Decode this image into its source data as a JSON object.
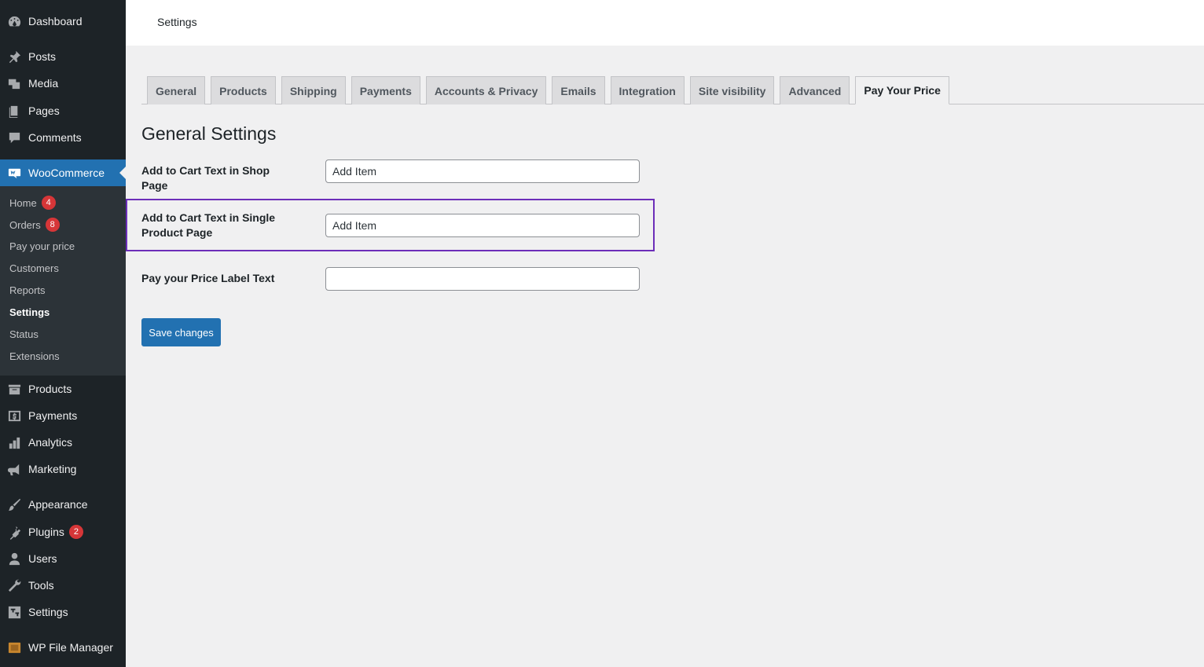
{
  "sidebar": {
    "menu": [
      {
        "label": "Dashboard",
        "icon": "dashboard-icon"
      },
      {
        "label": "Posts",
        "icon": "pin-icon"
      },
      {
        "label": "Media",
        "icon": "media-icon"
      },
      {
        "label": "Pages",
        "icon": "pages-icon"
      },
      {
        "label": "Comments",
        "icon": "comment-icon"
      },
      {
        "label": "WooCommerce",
        "icon": "woo-icon"
      },
      {
        "label": "Products",
        "icon": "archive-icon"
      },
      {
        "label": "Payments",
        "icon": "dollar-icon"
      },
      {
        "label": "Analytics",
        "icon": "bar-chart-icon"
      },
      {
        "label": "Marketing",
        "icon": "megaphone-icon"
      },
      {
        "label": "Appearance",
        "icon": "brush-icon"
      },
      {
        "label": "Plugins",
        "icon": "plug-icon",
        "badge": "2"
      },
      {
        "label": "Users",
        "icon": "user-icon"
      },
      {
        "label": "Tools",
        "icon": "wrench-icon"
      },
      {
        "label": "Settings",
        "icon": "settings-icon"
      },
      {
        "label": "WP File Manager",
        "icon": "file-manager-icon"
      }
    ],
    "submenu": [
      {
        "label": "Home",
        "badge": "4"
      },
      {
        "label": "Orders",
        "badge": "8"
      },
      {
        "label": "Pay your price"
      },
      {
        "label": "Customers"
      },
      {
        "label": "Reports"
      },
      {
        "label": "Settings"
      },
      {
        "label": "Status"
      },
      {
        "label": "Extensions"
      }
    ]
  },
  "header": {
    "title": "Settings"
  },
  "tabs": [
    {
      "label": "General"
    },
    {
      "label": "Products"
    },
    {
      "label": "Shipping"
    },
    {
      "label": "Payments"
    },
    {
      "label": "Accounts & Privacy"
    },
    {
      "label": "Emails"
    },
    {
      "label": "Integration"
    },
    {
      "label": "Site visibility"
    },
    {
      "label": "Advanced"
    },
    {
      "label": "Pay Your Price"
    }
  ],
  "main": {
    "section_title": "General Settings",
    "fields": [
      {
        "label": "Add to Cart Text in Shop Page",
        "value": "Add Item"
      },
      {
        "label": "Add to Cart Text in Single Product Page",
        "value": "Add Item"
      },
      {
        "label": "Pay your Price Label Text",
        "value": ""
      }
    ],
    "save_label": "Save changes"
  },
  "colors": {
    "sidebar_bg": "#1d2327",
    "submenu_bg": "#2c3338",
    "accent": "#2271b1",
    "highlight_border": "#6c2eb9",
    "badge": "#d63638"
  }
}
